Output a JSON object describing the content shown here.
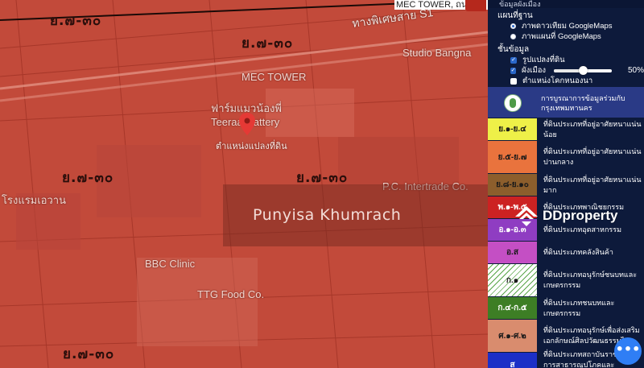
{
  "map": {
    "search_chip": "MEC TOWER, ถนน",
    "zone_labels": [
      "ย.๗-๓๐",
      "ย.๗-๓๐",
      "ย.๗-๓๐",
      "ย.๗-๓๐",
      "ย.๗-๓๐"
    ],
    "road_label": "ทางพิเศษสาย S1",
    "place_labels": [
      "MEC TOWER",
      "Studio Bangna",
      "ฟาร์มแมวน้องพี่",
      "Teeraa Cattery",
      "P.C. Intertrade Co.",
      "BBC Clinic",
      "TTG Food Co.",
      "โรงแรมเอวาน"
    ],
    "pin_caption": "ตำแหน่งแปลงที่ดิน",
    "watermark_name": "Punyisa Khumrach",
    "brand": "DDproperty",
    "colors": {
      "zone_overlay": "#c94f3f"
    }
  },
  "panel": {
    "header": "ข้อมูลผังเมือง",
    "basemap_title": "แผนที่ฐาน",
    "basemap_options": [
      {
        "label": "ภาพดาวเทียม GoogleMaps",
        "selected": true
      },
      {
        "label": "ภาพแผนที่ GoogleMaps",
        "selected": false
      }
    ],
    "layers_title": "ชั้นข้อมูล",
    "layers": {
      "parcels": {
        "label": "รูปแปลงที่ดิน",
        "checked": true
      },
      "cityplan": {
        "label": "ผังเมือง",
        "checked": true,
        "opacity_percent": 50,
        "opacity_label": "50%"
      },
      "nongbon": {
        "label": "ตำแหน่งโคกหนองนา",
        "checked": false
      }
    },
    "partner": "การบูรณาการข้อมูลร่วมกับกรุงเทพมหานคร",
    "legend": [
      {
        "code": "ย.๑-ย.๔",
        "desc": "ที่ดินประเภทที่อยู่อาศัยหนาแน่นน้อย",
        "color": "#eef048"
      },
      {
        "code": "ย.๕-ย.๗",
        "desc": "ที่ดินประเภทที่อยู่อาศัยหนาแน่นปานกลาง",
        "color": "#e9733d"
      },
      {
        "code": "ย.๘-ย.๑๐",
        "desc": "ที่ดินประเภทที่อยู่อาศัยหนาแน่นมาก",
        "color": "#8c5e2c"
      },
      {
        "code": "พ.๑-พ.๕",
        "desc": "ที่ดินประเภทพาณิชยกรรม",
        "color": "#cc2222"
      },
      {
        "code": "อ.๑-อ.๓",
        "desc": "ที่ดินประเภทอุตสาหกรรม",
        "color": "#8f3dc2"
      },
      {
        "code": "อ.ส",
        "desc": "ที่ดินประเภทคลังสินค้า",
        "color": "#c44fc4"
      },
      {
        "code": "ก.๑",
        "desc": "ที่ดินประเภทอนุรักษ์ชนบทและเกษตรกรรม",
        "color": "#ffffff"
      },
      {
        "code": "ก.๔-ก.๕",
        "desc": "ที่ดินประเภทชนบทและเกษตรกรรม",
        "color": "#3d7e25"
      },
      {
        "code": "ศ.๑-ศ.๒",
        "desc": "ที่ดินประเภทอนุรักษ์เพื่อส่งเสริมเอกลักษณ์ศิลปวัฒนธรรมไทย",
        "color": "#d98c6e"
      },
      {
        "code": "ส",
        "desc": "ที่ดินประเภทสถาบันราชการ การสาธารณูปโภคและสาธารณูปการ",
        "color": "#1c2fc7"
      }
    ]
  }
}
